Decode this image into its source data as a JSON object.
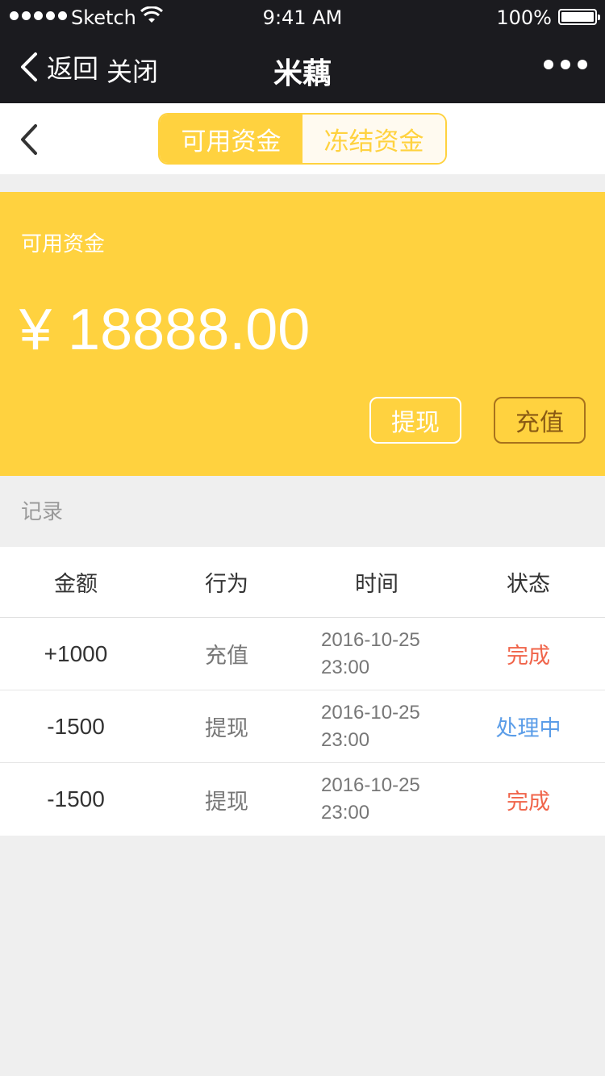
{
  "status_bar": {
    "carrier": "Sketch",
    "time": "9:41 AM",
    "battery": "100%"
  },
  "nav": {
    "back_label": "返回",
    "close_label": "关闭",
    "title": "米藕",
    "more_icon": "more-dots-icon"
  },
  "segment": {
    "tabs": [
      {
        "label": "可用资金",
        "active": true
      },
      {
        "label": "冻结资金",
        "active": false
      }
    ]
  },
  "balance": {
    "label": "可用资金",
    "amount": "¥ 18888.00",
    "withdraw_label": "提现",
    "recharge_label": "充值"
  },
  "records": {
    "section_label": "记录",
    "headers": [
      "金额",
      "行为",
      "时间",
      "状态"
    ],
    "rows": [
      {
        "amount": "+1000",
        "action": "充值",
        "date": "2016-10-25",
        "time": "23:00",
        "status": "完成",
        "status_color": "#f0644a"
      },
      {
        "amount": "-1500",
        "action": "提现",
        "date": "2016-10-25",
        "time": "23:00",
        "status": "处理中",
        "status_color": "#5b9de8"
      },
      {
        "amount": "-1500",
        "action": "提现",
        "date": "2016-10-25",
        "time": "23:00",
        "status": "完成",
        "status_color": "#f0644a"
      }
    ]
  },
  "colors": {
    "accent": "#ffd23f",
    "dark_bar": "#1b1b1f",
    "status_done": "#f0644a",
    "status_processing": "#5b9de8"
  }
}
